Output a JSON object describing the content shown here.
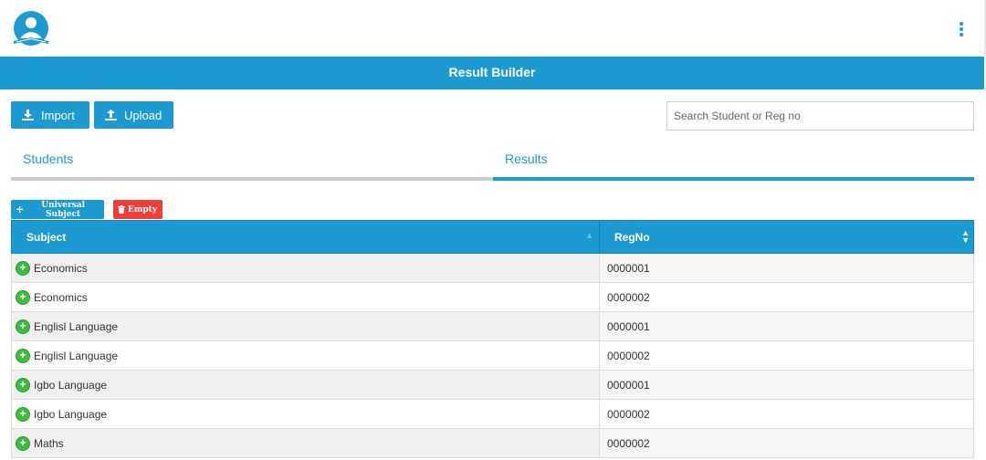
{
  "header": {
    "logo_icon": "student-reading-logo-icon",
    "menu_icon": "kebab-menu-icon"
  },
  "banner": {
    "title": "Result Builder"
  },
  "toolbar": {
    "import_label": "Import",
    "upload_label": "Upload",
    "search_placeholder": "Search Student or Reg no"
  },
  "tabs": [
    {
      "label": "Students",
      "active": false
    },
    {
      "label": "Results",
      "active": true
    }
  ],
  "actions": {
    "universal_label": "Universal Subject",
    "empty_label": "Empty"
  },
  "table": {
    "columns": [
      "Subject",
      "RegNo"
    ],
    "rows": [
      {
        "subject": "Economics",
        "regno": "0000001"
      },
      {
        "subject": "Economics",
        "regno": "0000002"
      },
      {
        "subject": "Englisl Language",
        "regno": "0000001"
      },
      {
        "subject": "Englisl Language",
        "regno": "0000002"
      },
      {
        "subject": "Igbo Language",
        "regno": "0000001"
      },
      {
        "subject": "Igbo Language",
        "regno": "0000002"
      },
      {
        "subject": "Maths",
        "regno": "0000002"
      }
    ]
  },
  "colors": {
    "accent": "#1d9bd1",
    "danger": "#ef3e3a",
    "expand": "#3dbd3d"
  }
}
